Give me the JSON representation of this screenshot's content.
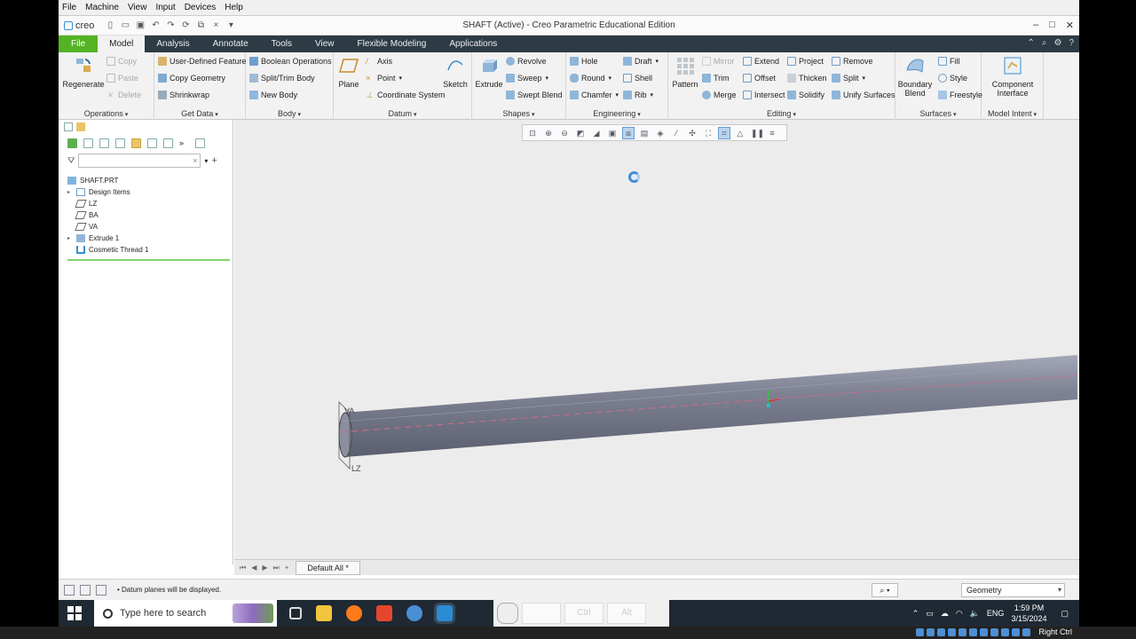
{
  "vm_menu": [
    "File",
    "Machine",
    "View",
    "Input",
    "Devices",
    "Help"
  ],
  "app": {
    "logo_text": "creo",
    "window_title": "SHAFT (Active) - Creo Parametric Educational Edition"
  },
  "tabs": [
    "File",
    "Model",
    "Analysis",
    "Annotate",
    "Tools",
    "View",
    "Flexible Modeling",
    "Applications"
  ],
  "active_tab": "Model",
  "ribbon": {
    "operations": {
      "label": "Operations",
      "regenerate": "Regenerate",
      "copy": "Copy",
      "paste": "Paste",
      "delete": "Delete"
    },
    "get_data": {
      "label": "Get Data",
      "udf": "User-Defined Feature",
      "copy_geometry": "Copy Geometry",
      "shrinkwrap": "Shrinkwrap"
    },
    "body": {
      "label": "Body",
      "boolean": "Boolean Operations",
      "split_trim": "Split/Trim Body",
      "new_body": "New Body"
    },
    "datum": {
      "label": "Datum",
      "plane": "Plane",
      "axis": "Axis",
      "point": "Point",
      "coord_sys": "Coordinate System",
      "sketch": "Sketch"
    },
    "shapes": {
      "label": "Shapes",
      "extrude": "Extrude",
      "revolve": "Revolve",
      "sweep": "Sweep",
      "swept_blend": "Swept Blend"
    },
    "engineering": {
      "label": "Engineering",
      "hole": "Hole",
      "round": "Round",
      "chamfer": "Chamfer",
      "draft": "Draft",
      "shell": "Shell",
      "rib": "Rib"
    },
    "editing": {
      "label": "Editing",
      "pattern": "Pattern",
      "mirror": "Mirror",
      "trim": "Trim",
      "merge": "Merge",
      "extend": "Extend",
      "offset": "Offset",
      "intersect": "Intersect",
      "project": "Project",
      "thicken": "Thicken",
      "solidify": "Solidify",
      "remove": "Remove",
      "split": "Split",
      "unify": "Unify Surfaces"
    },
    "surfaces": {
      "label": "Surfaces",
      "boundary_blend_1": "Boundary",
      "boundary_blend_2": "Blend",
      "fill": "Fill",
      "style": "Style",
      "freestyle": "Freestyle"
    },
    "model_intent": {
      "label": "Model Intent",
      "component_1": "Component",
      "component_2": "Interface"
    }
  },
  "tree": {
    "root": "SHAFT.PRT",
    "items": [
      {
        "label": "Design Items",
        "expandable": true,
        "icon": "design-items-icon"
      },
      {
        "label": "LZ",
        "expandable": false,
        "icon": "datum-plane-icon"
      },
      {
        "label": "BA",
        "expandable": false,
        "icon": "datum-plane-icon"
      },
      {
        "label": "VA",
        "expandable": false,
        "icon": "datum-plane-icon"
      },
      {
        "label": "Extrude 1",
        "expandable": true,
        "icon": "extrude-icon"
      },
      {
        "label": "Cosmetic Thread 1",
        "expandable": false,
        "icon": "thread-icon"
      }
    ]
  },
  "viewport": {
    "datum_labels": {
      "va": "VA",
      "lz": "LZ"
    }
  },
  "view_tab": "Default All *",
  "status_message": "Datum planes will be displayed.",
  "selection_filter": "Geometry",
  "taskbar": {
    "search_placeholder": "Type here to search",
    "overlay_keys": [
      "Ctrl",
      "Alt"
    ],
    "lang": "ENG",
    "time": "1:59 PM",
    "date": "3/15/2024"
  },
  "host": {
    "right_ctrl": "Right Ctrl"
  },
  "colors": {
    "accent_green": "#53b324",
    "tabbar": "#2c3b44",
    "shaft": "#6b6f80",
    "tree_line": "#7fd36a"
  }
}
